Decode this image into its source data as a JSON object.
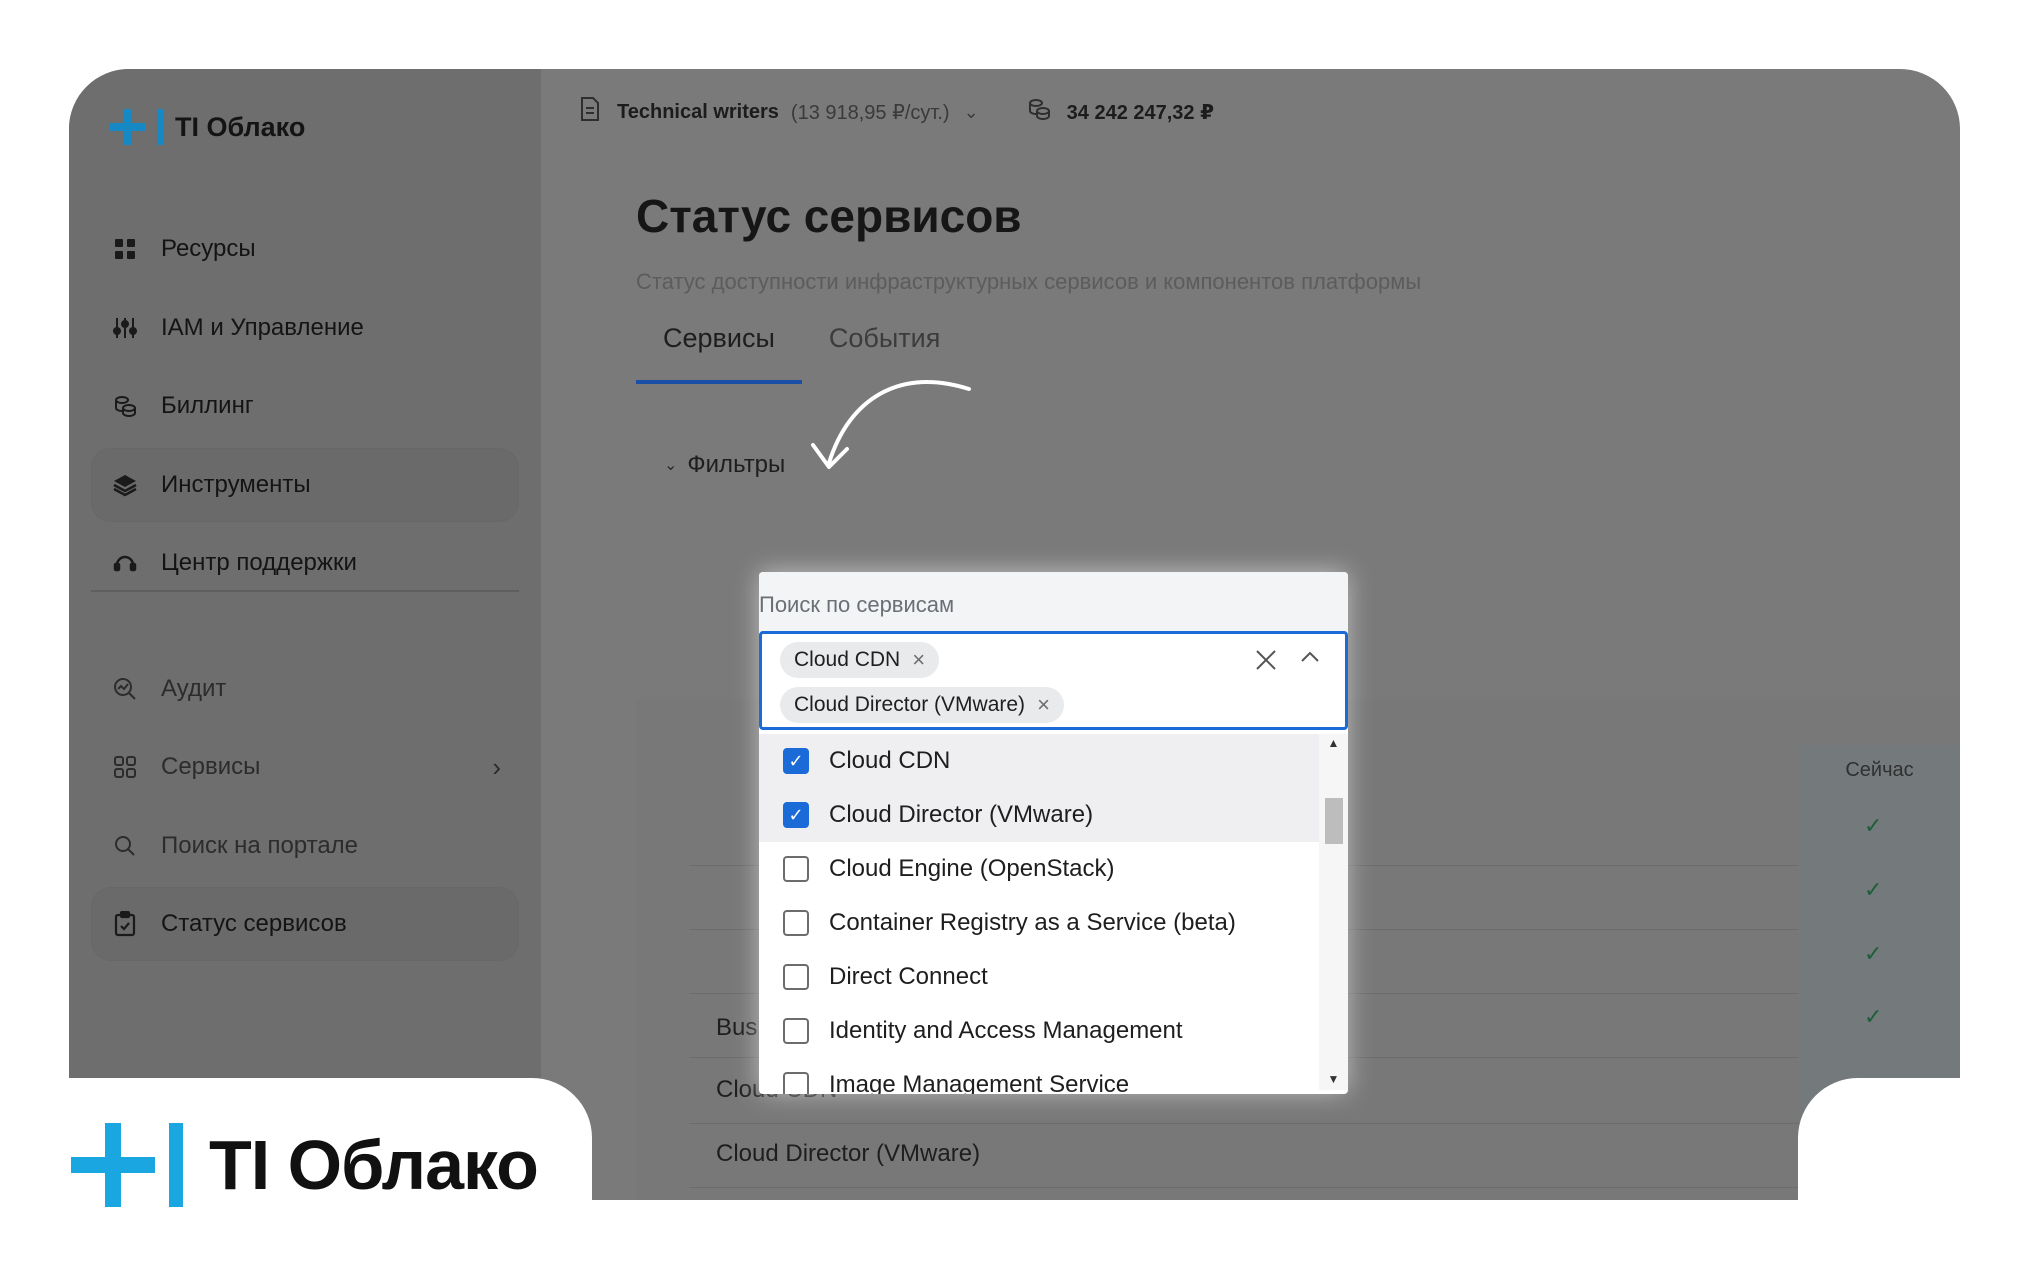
{
  "app": {
    "logo_text": "TI Облако",
    "brand_logo_text": "TI Облако"
  },
  "sidebar": {
    "items": [
      {
        "label": "Ресурсы",
        "icon": "grid-icon"
      },
      {
        "label": "IAM и Управление",
        "icon": "sliders-icon"
      },
      {
        "label": "Биллинг",
        "icon": "coins-icon"
      },
      {
        "label": "Инструменты",
        "icon": "layers-icon",
        "active": true
      },
      {
        "label": "Центр поддержки",
        "icon": "headset-icon"
      }
    ],
    "secondary": [
      {
        "label": "Аудит",
        "icon": "audit-icon"
      },
      {
        "label": "Сервисы",
        "icon": "apps-icon"
      },
      {
        "label": "Поиск на портале",
        "icon": "search-icon"
      },
      {
        "label": "Статус сервисов",
        "icon": "clipboard-icon",
        "active": true
      }
    ]
  },
  "topbar": {
    "project": "Technical writers",
    "rate": "(13 918,95 ₽/сут.)",
    "balance": "34 242 247,32 ₽"
  },
  "page": {
    "title": "Статус сервисов",
    "subtitle": "Статус доступности инфраструктурных сервисов и компонентов платформы",
    "tabs": [
      "Сервисы",
      "События"
    ],
    "filters_label": "Фильтры"
  },
  "table": {
    "now_header": "Сейчас",
    "rows": [
      "Business Account",
      "Cloud CDN",
      "Cloud Director (VMware)"
    ]
  },
  "dropdown": {
    "label": "Поиск по сервисам",
    "chips": [
      "Cloud CDN",
      "Cloud Director (VMware)"
    ],
    "options": [
      {
        "label": "Cloud CDN",
        "checked": true
      },
      {
        "label": "Cloud Director (VMware)",
        "checked": true
      },
      {
        "label": "Cloud Engine (OpenStack)",
        "checked": false
      },
      {
        "label": "Container Registry as a Service (beta)",
        "checked": false
      },
      {
        "label": "Direct Connect",
        "checked": false
      },
      {
        "label": "Identity and Access Management",
        "checked": false
      },
      {
        "label": "Image Management Service",
        "checked": false
      }
    ]
  },
  "colors": {
    "accent": "#1a6ad8",
    "brand": "#1aa6e0",
    "overlay": "#7a7a7a"
  }
}
